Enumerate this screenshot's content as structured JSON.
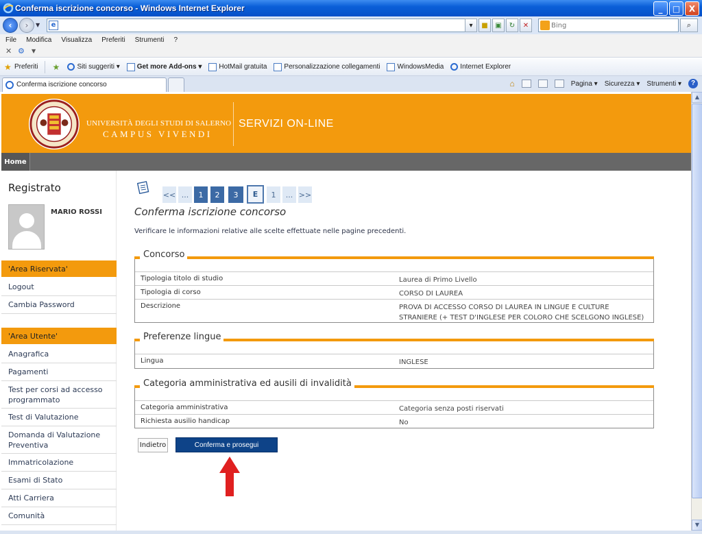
{
  "window": {
    "title": "Conferma iscrizione concorso - Windows Internet Explorer",
    "controls": [
      "_",
      "□",
      "X"
    ]
  },
  "address_bar": {
    "url": "",
    "search_placeholder": "Bing"
  },
  "menu": [
    "File",
    "Modifica",
    "Visualizza",
    "Preferiti",
    "Strumenti",
    "?"
  ],
  "favorites_bar": {
    "favorites_label": "Preferiti",
    "items": [
      "Siti suggeriti ▾",
      "Get more Add-ons ▾",
      "HotMail gratuita",
      "Personalizzazione collegamenti",
      "WindowsMedia",
      "Internet Explorer"
    ]
  },
  "tabs": {
    "active": "Conferma iscrizione concorso"
  },
  "tab_tools": {
    "pagina": "Pagina ▾",
    "sicurezza": "Sicurezza ▾",
    "strumenti": "Strumenti ▾"
  },
  "header": {
    "university": "UNIVERSITÀ DEGLI STUDI DI SALERNO",
    "motto": "CAMPUS VIVENDI",
    "service": "SERVIZI ON-LINE"
  },
  "nav": {
    "home": "Home"
  },
  "sidebar": {
    "title": "Registrato",
    "user_name": "MARIO ROSSI",
    "area_riservata": {
      "label": "'Area Riservata'",
      "links": [
        "Logout",
        "Cambia Password"
      ]
    },
    "area_utente": {
      "label": "'Area Utente'",
      "links": [
        "Anagrafica",
        "Pagamenti",
        "Test per corsi ad accesso programmato",
        "Test di Valutazione",
        "Domanda di Valutazione Preventiva",
        "Immatricolazione",
        "Esami di Stato",
        "Atti Carriera",
        "Comunità"
      ]
    }
  },
  "wizard": {
    "steps": [
      {
        "label": "<<",
        "style": "light"
      },
      {
        "label": "...",
        "style": "light"
      },
      {
        "label": "1",
        "style": "dark"
      },
      {
        "label": "2",
        "style": "dark"
      },
      {
        "label": "3",
        "style": "dark"
      },
      {
        "label": "E",
        "style": "current"
      },
      {
        "label": "1",
        "style": "light"
      },
      {
        "label": "...",
        "style": "light"
      },
      {
        "label": ">>",
        "style": "light"
      }
    ]
  },
  "main": {
    "title": "Conferma iscrizione concorso",
    "intro": "Verificare le informazioni relative alle scelte effettuate nelle pagine precedenti.",
    "sections": [
      {
        "legend": "Concorso",
        "rows": [
          {
            "label": "Tipologia titolo di studio",
            "value": "Laurea di Primo Livello"
          },
          {
            "label": "Tipologia di corso",
            "value": "CORSO DI LAUREA"
          },
          {
            "label": "Descrizione",
            "value": "PROVA DI ACCESSO CORSO DI LAUREA IN LINGUE E CULTURE STRANIERE (+ TEST D'INGLESE PER COLORO CHE SCELGONO INGLESE)"
          }
        ]
      },
      {
        "legend": "Preferenze lingue",
        "rows": [
          {
            "label": "Lingua",
            "value": "INGLESE"
          }
        ]
      },
      {
        "legend": "Categoria amministrativa ed ausili di invalidità",
        "rows": [
          {
            "label": "Categoria amministrativa",
            "value": "Categoria senza posti riservati"
          },
          {
            "label": "Richiesta ausilio handicap",
            "value": "No"
          }
        ]
      }
    ],
    "buttons": {
      "back": "Indietro",
      "confirm": "Conferma e prosegui"
    }
  },
  "colors": {
    "accent_orange": "#f39a0d",
    "nav_gray": "#676767",
    "confirm_blue": "#0e4388",
    "arrow_red": "#e02020"
  }
}
